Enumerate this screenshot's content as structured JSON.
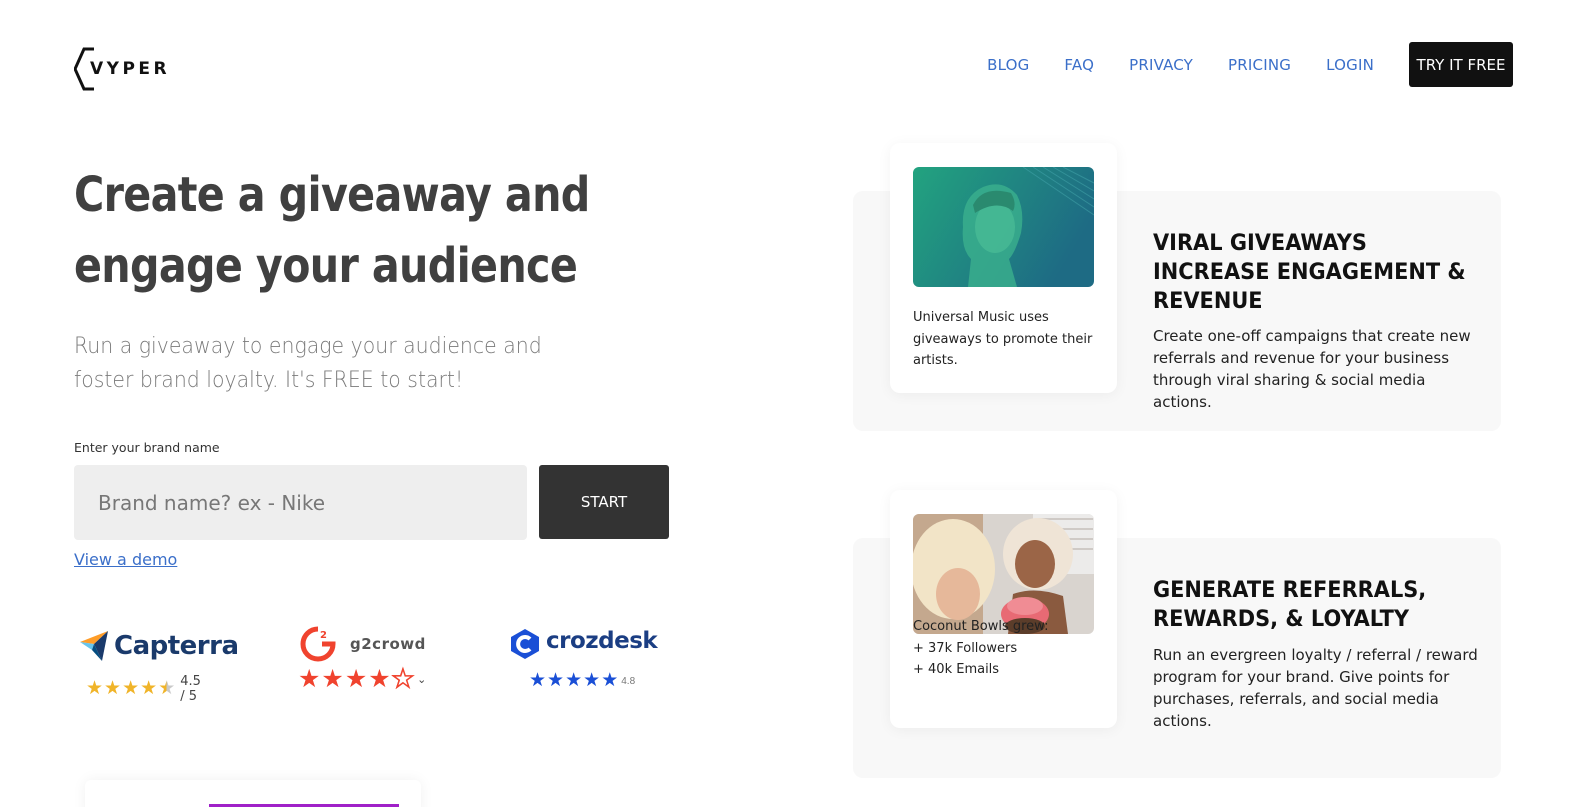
{
  "header": {
    "logo_text": "VYPER",
    "nav": [
      {
        "label": "BLOG"
      },
      {
        "label": "FAQ"
      },
      {
        "label": "PRIVACY"
      },
      {
        "label": "PRICING"
      },
      {
        "label": "LOGIN"
      }
    ],
    "cta_label": "TRY IT FREE"
  },
  "hero": {
    "title_line1": "Create a giveaway and",
    "title_line2": "engage your audience",
    "subtitle_line1": "Run a giveaway to engage your audience and",
    "subtitle_line2": "foster brand loyalty. It's FREE to start!",
    "input_label": "Enter your brand name",
    "input_placeholder": "Brand name? ex - Nike",
    "start_label": "START",
    "demo_link": "View a demo"
  },
  "ratings": {
    "capterra": {
      "name": "Capterra",
      "score": "4.5 / 5",
      "stars": 4.5
    },
    "g2": {
      "name": "g2crowd",
      "stars": 4.5
    },
    "crozdesk": {
      "name": "crozdesk",
      "score": "4.8",
      "stars": 5
    }
  },
  "features": [
    {
      "case_lines": [
        "Universal Music uses",
        "giveaways to promote their",
        "artists."
      ],
      "title_lines": [
        "VIRAL GIVEAWAYS",
        "INCREASE ENGAGEMENT &",
        "REVENUE"
      ],
      "description": "Create one-off campaigns that create new referrals and revenue for your business through viral sharing & social media actions."
    },
    {
      "case_lines": [
        "Coconut Bowls grew:",
        "+ 37k Followers",
        "+ 40k Emails"
      ],
      "title_lines": [
        "GENERATE REFERRALS,",
        "REWARDS, & LOYALTY"
      ],
      "description": "Run an evergreen loyalty / referral / reward program for your brand. Give points for purchases, referrals, and social media actions."
    }
  ],
  "colors": {
    "nav_link": "#3b6fc9",
    "cta_bg": "#111111",
    "start_bg": "#333333",
    "feature_bg": "#f8f8f8",
    "capterra_star": "#f0b429",
    "g2_star": "#f0432e",
    "crozdesk_star": "#1a4fd6"
  }
}
